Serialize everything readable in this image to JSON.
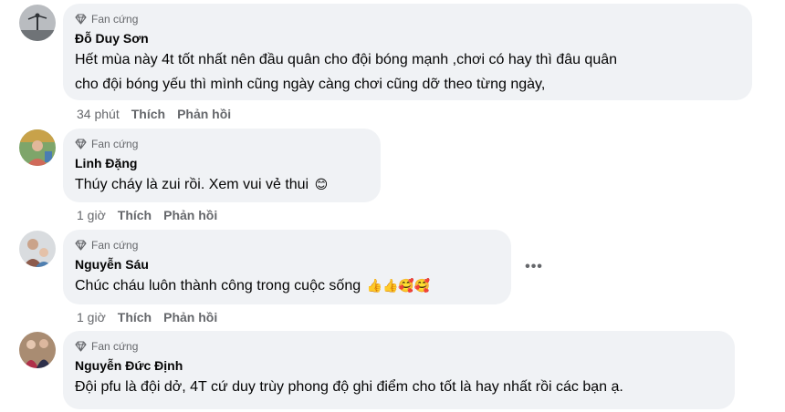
{
  "comments": [
    {
      "badge": "Fan cứng",
      "author": "Đỗ Duy Sơn",
      "lines": [
        "Hết mùa này 4t tốt nhất nên đầu quân cho đội bóng mạnh ,chơi có hay thì đâu quân",
        "cho đội bóng yếu thì mình cũng ngày càng chơi cũng dỡ theo từng ngày,"
      ],
      "time": "34 phút",
      "like": "Thích",
      "reply": "Phản hồi"
    },
    {
      "badge": "Fan cứng",
      "author": "Linh Đặng",
      "lines": [
        "Thúy cháy là zui rồi. Xem vui vẻ thui"
      ],
      "emojis": "😊",
      "time": "1 giờ",
      "like": "Thích",
      "reply": "Phản hồi"
    },
    {
      "badge": "Fan cứng",
      "author": "Nguyễn Sáu",
      "lines": [
        "Chúc cháu luôn thành công trong cuộc sống"
      ],
      "emojis": "👍👍🥰🥰",
      "time": "1 giờ",
      "like": "Thích",
      "reply": "Phản hồi",
      "more": "•••"
    },
    {
      "badge": "Fan cứng",
      "author": "Nguyễn Đức Định",
      "lines": [
        "Đội pfu là đội dở, 4T cứ duy trùy phong độ ghi điểm cho tốt là hay nhất rồi các bạn ạ."
      ]
    }
  ],
  "colors": {
    "bubble": "#f0f2f5",
    "secondary_text": "#65676b",
    "primary_text": "#050505"
  },
  "icons": {
    "badge": "diamond-icon",
    "more": "more-options-icon"
  }
}
